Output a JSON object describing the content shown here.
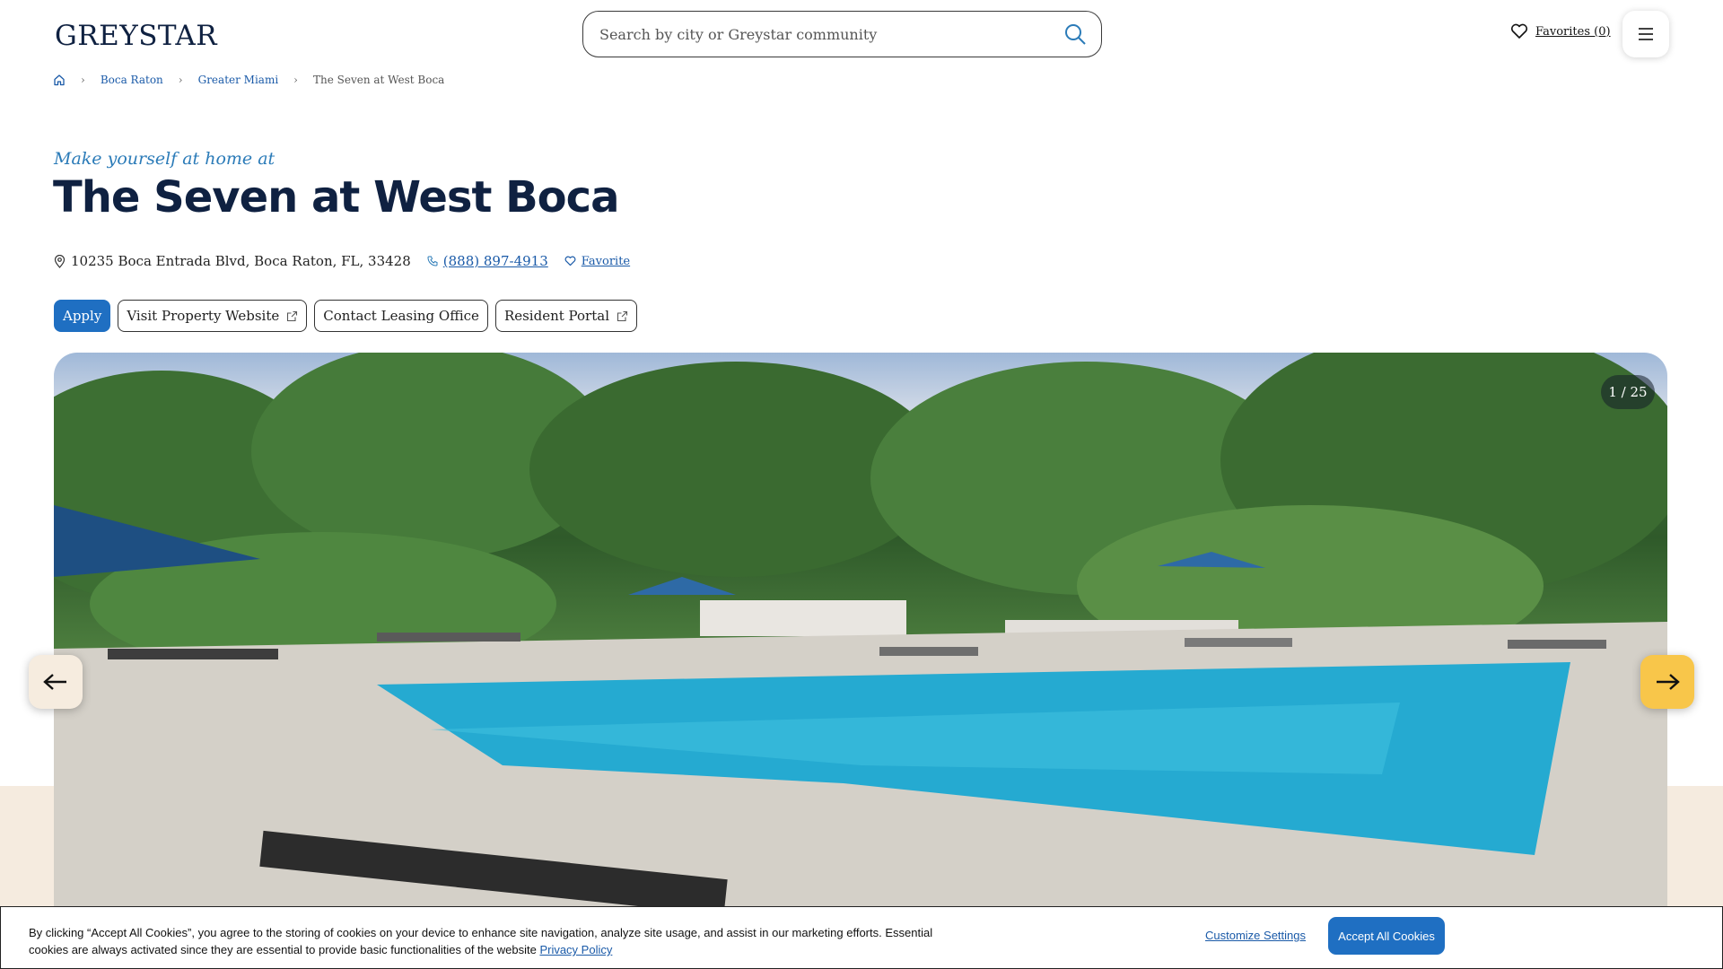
{
  "header": {
    "logo": "GREYSTAR",
    "search_placeholder": "Search by city or Greystar community",
    "favorites_label": "Favorites (0)"
  },
  "breadcrumb": {
    "items": [
      "Boca Raton",
      "Greater Miami",
      "The Seven at West Boca"
    ]
  },
  "property": {
    "tagline": "Make yourself at home at",
    "name": "The Seven at West Boca",
    "address": "10235 Boca Entrada Blvd, Boca Raton, FL, 33428",
    "phone": "(888) 897-4913",
    "favorite_label": "Favorite"
  },
  "actions": {
    "apply": "Apply",
    "visit_website": "Visit Property Website",
    "contact_leasing": "Contact Leasing Office",
    "resident_portal": "Resident Portal"
  },
  "gallery": {
    "counter": "1 / 25"
  },
  "cookie": {
    "text": "By clicking “Accept All Cookies”, you agree to the storing of cookies on your device to enhance site navigation, analyze site usage, and assist in our marketing efforts. Essential cookies are always activated since they are essential to provide basic functionalities of the website",
    "privacy_link": "Privacy Policy",
    "customize": "Customize Settings",
    "accept": "Accept All Cookies"
  },
  "colors": {
    "navy": "#0f2141",
    "blue": "#1f6fc2",
    "accent_yellow": "#f8c64a",
    "beige": "#f5ebdf"
  }
}
